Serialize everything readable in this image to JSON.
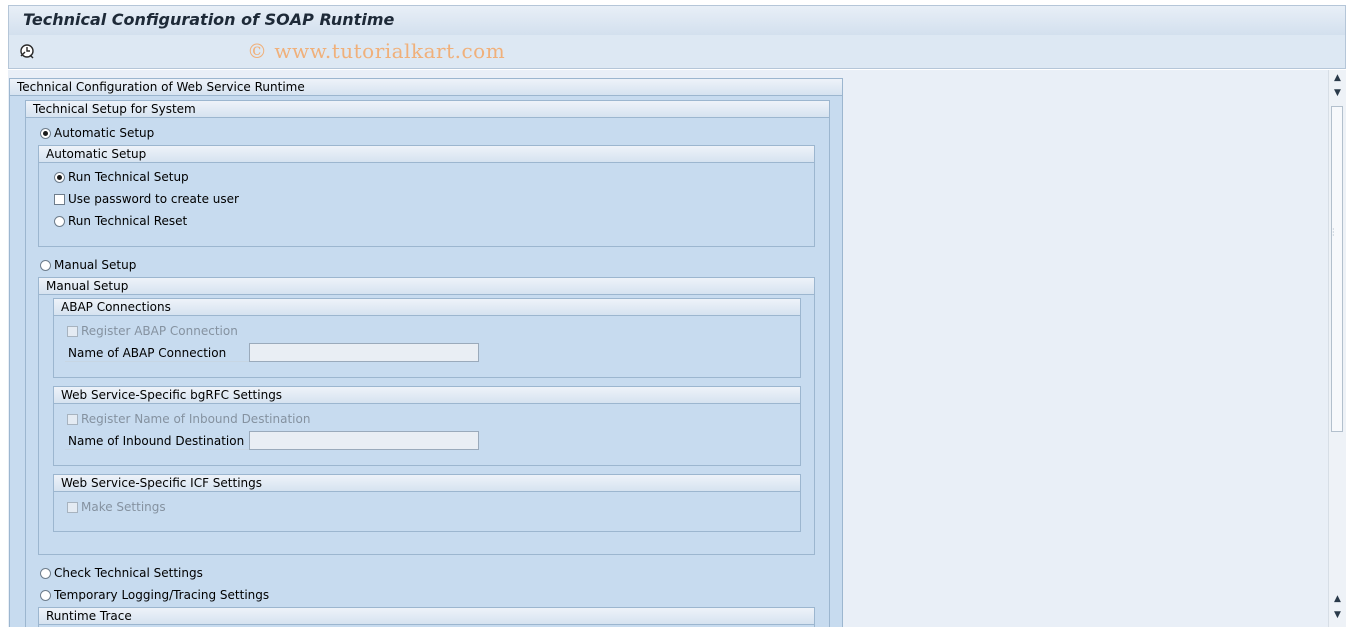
{
  "header": {
    "title": "Technical Configuration of SOAP Runtime",
    "watermark": "© www.tutorialkart.com"
  },
  "toolbar": {
    "execute_icon": "execute-clock-icon"
  },
  "main": {
    "outer_group": "Technical Configuration of Web Service Runtime",
    "system_group": "Technical Setup for System",
    "automatic_setup_radio": "Automatic Setup",
    "automatic_setup_group": "Automatic Setup",
    "run_technical_setup": "Run Technical Setup",
    "use_password": "Use password to create user",
    "run_technical_reset": "Run Technical Reset",
    "manual_setup_radio": "Manual Setup",
    "manual_setup_group": "Manual Setup",
    "abap_group": "ABAP Connections",
    "register_abap": "Register ABAP Connection",
    "name_abap_label": "Name of ABAP Connection",
    "name_abap_value": "",
    "bgrfc_group": "Web Service-Specific bgRFC Settings",
    "register_inbound": "Register Name of Inbound Destination",
    "name_inbound_label": "Name of Inbound Destination",
    "name_inbound_value": "",
    "icf_group": "Web Service-Specific ICF Settings",
    "make_settings": "Make Settings",
    "check_technical": "Check Technical Settings",
    "temp_logging": "Temporary Logging/Tracing Settings",
    "runtime_trace_group": "Runtime Trace"
  },
  "colors": {
    "panel": "#c7dbef",
    "header": "#d6e3f0",
    "watermark": "#f0b07a"
  }
}
